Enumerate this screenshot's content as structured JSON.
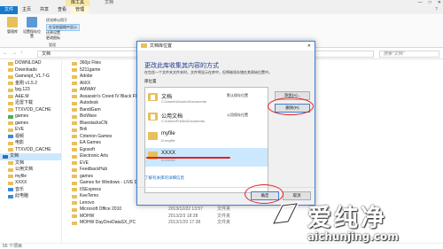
{
  "window": {
    "context_tab": "库工具",
    "title": "文档",
    "controls": [
      "—",
      "□",
      "✕"
    ]
  },
  "tabs": [
    "文件",
    "主页",
    "共享",
    "查看",
    "管理"
  ],
  "help": "?",
  "ribbon": {
    "btn_manage": "管理库",
    "btn_set": "设置保存位置",
    "small_opt": "优化库以用于",
    "small_show": "在导航窗格中显示",
    "small_restore": "还原设置",
    "small_change": "更改图标",
    "group": "管理"
  },
  "address": {
    "path": "文档",
    "search_placeholder": "搜索\"文档\""
  },
  "sidebar": [
    "DOWNLOAD",
    "Downloads",
    "Gamespt_V1.7-G",
    "金刚 v1.5.2",
    "Ipg.123",
    "A&E.M",
    "迅雷下载",
    "TTXVOD_CACHE",
    "games",
    "games",
    "EVE",
    "视频",
    "电影",
    "TTXVOD_CACHE",
    "文档",
    "文档",
    "公用文档",
    "myfile",
    "XXXX",
    "音乐",
    "此电脑"
  ],
  "files": [
    {
      "name": "360js Files",
      "date": "",
      "type": ""
    },
    {
      "name": "5211game",
      "date": "",
      "type": ""
    },
    {
      "name": "Adobe",
      "date": "",
      "type": ""
    },
    {
      "name": "AliXX",
      "date": "",
      "type": ""
    },
    {
      "name": "AMWAY",
      "date": "",
      "type": ""
    },
    {
      "name": "Assassin's Creed IV Black Flag",
      "date": "",
      "type": ""
    },
    {
      "name": "Autodesk",
      "date": "",
      "type": ""
    },
    {
      "name": "BandiGam",
      "date": "",
      "type": ""
    },
    {
      "name": "BioWare",
      "date": "",
      "type": ""
    },
    {
      "name": "BluestacksCN",
      "date": "",
      "type": ""
    },
    {
      "name": "Bnli",
      "date": "",
      "type": ""
    },
    {
      "name": "Criterion Games",
      "date": "",
      "type": ""
    },
    {
      "name": "EA Games",
      "date": "",
      "type": ""
    },
    {
      "name": "Egosoft",
      "date": "",
      "type": ""
    },
    {
      "name": "Electronic Arts",
      "date": "",
      "type": ""
    },
    {
      "name": "EVE",
      "date": "",
      "type": ""
    },
    {
      "name": "FeedbackHub",
      "date": "",
      "type": ""
    },
    {
      "name": "games",
      "date": "",
      "type": ""
    },
    {
      "name": "Games for Windows - LIVE Demos",
      "date": "",
      "type": ""
    },
    {
      "name": "IISExpress",
      "date": "2017/1/29 14:47",
      "type": "文件夹"
    },
    {
      "name": "KeeTemo",
      "date": "2015/1/25 12:51",
      "type": "文件夹"
    },
    {
      "name": "Lenovo",
      "date": "2017/12/11 22:55",
      "type": "文件夹"
    },
    {
      "name": "Microsoft Office 2010",
      "date": "2013/12/22 13:57",
      "type": "文件夹"
    },
    {
      "name": "MOHW",
      "date": "2013/2/3 18:38",
      "type": "文件夹"
    },
    {
      "name": "MOHW DayOneDataSX_PC",
      "date": "2013/1/20 17:38",
      "type": "文件夹"
    }
  ],
  "status": "55 个项目",
  "dialog": {
    "title": "文档库位置",
    "heading": "更改此库收集其内容的方式",
    "desc": "在包含一个文件夹文件夹时，文件将显示在库中，但将继续存储在其原始位置中。",
    "loc_label": "库位置",
    "locations": [
      {
        "name": "文档",
        "path": "C:\\Users\\Ubuntu\\Documents",
        "tag": "默认保存位置",
        "tag2": ""
      },
      {
        "name": "公用文档",
        "path": "C:\\Users\\Public\\Documents",
        "tag": "公用保存位置",
        "tag2": ""
      },
      {
        "name": "myfile",
        "path": "D:\\myfile",
        "tag": "",
        "tag2": ""
      },
      {
        "name": "XXXX",
        "path": "D:\\XXXX",
        "tag": "",
        "tag2": ""
      }
    ],
    "btn_add": "添加(A)...",
    "btn_remove": "删除(R)",
    "link": "了解有关库的详细信息",
    "ok": "确定",
    "cancel": "取消",
    "close": "✕"
  },
  "watermark": {
    "brand": "爱纯净",
    "url": "aichunjing.com"
  }
}
